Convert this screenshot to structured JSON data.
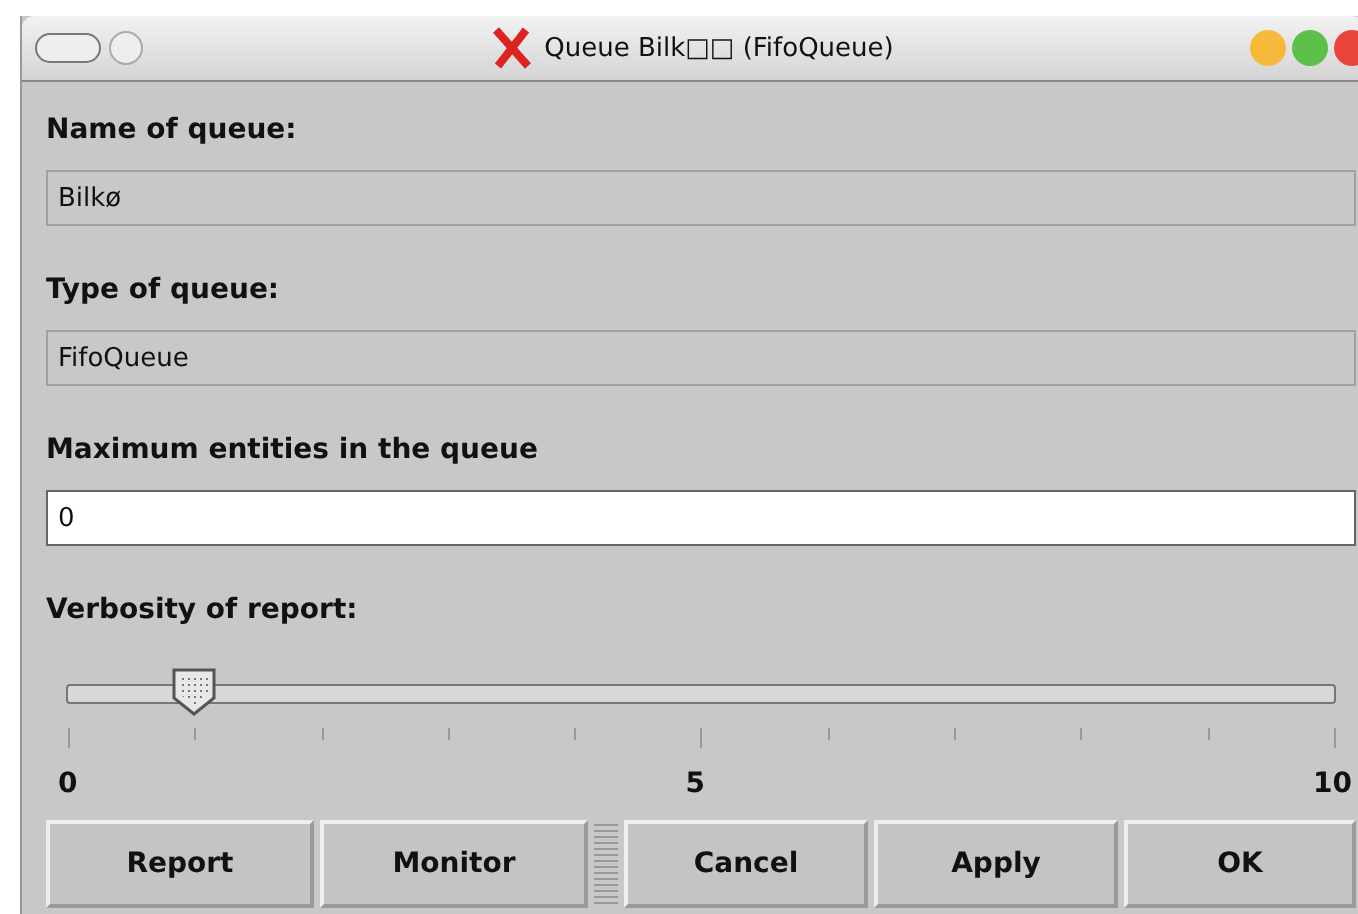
{
  "window": {
    "title": "Queue Bilk□□ (FifoQueue)"
  },
  "fields": [
    {
      "label": "Name of queue:",
      "value": "Bilkø",
      "editable": false
    },
    {
      "label": "Type of queue:",
      "value": "FifoQueue",
      "editable": false
    },
    {
      "label": "Maximum entities in the queue",
      "value": "0",
      "editable": true
    }
  ],
  "slider": {
    "label": "Verbosity of report:",
    "level": 0.1,
    "tick_labels": [
      "0",
      "5",
      "10"
    ]
  },
  "buttons_left": [
    "Report",
    "Monitor"
  ],
  "buttons_right": [
    "Cancel",
    "Apply",
    "OK"
  ]
}
